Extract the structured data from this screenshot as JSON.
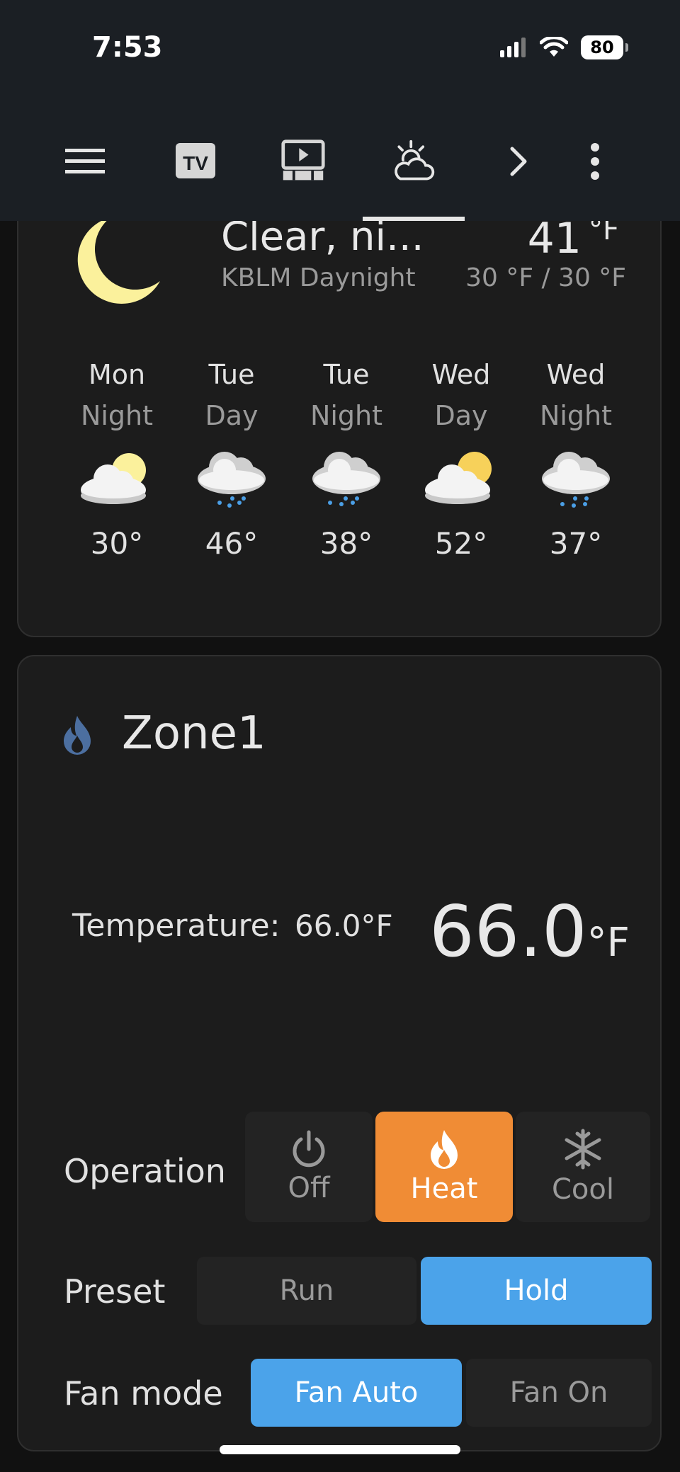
{
  "status": {
    "time": "7:53",
    "battery": "80"
  },
  "toolbar": {
    "icons": [
      "menu-icon",
      "tv-icon",
      "media-icon",
      "weather-icon",
      "chevron-right-icon",
      "more-vert-icon"
    ]
  },
  "weather": {
    "condition": "Clear, ni...",
    "station": "KBLM Daynight",
    "temperature": "41",
    "unit": "°F",
    "hilo": "30 °F / 30 °F",
    "forecast": [
      {
        "day": "Mon",
        "period": "Night",
        "temp": "30°",
        "icon": "partly-cloudy-icon"
      },
      {
        "day": "Tue",
        "period": "Day",
        "temp": "46°",
        "icon": "rain-icon"
      },
      {
        "day": "Tue",
        "period": "Night",
        "temp": "38°",
        "icon": "rain-icon"
      },
      {
        "day": "Wed",
        "period": "Day",
        "temp": "52°",
        "icon": "partly-cloudy-icon"
      },
      {
        "day": "Wed",
        "period": "Night",
        "temp": "37°",
        "icon": "rain-icon"
      }
    ]
  },
  "zone": {
    "title": "Zone1",
    "temperature_label": "Temperature:",
    "temperature_small": "66.0°F",
    "temperature_big": "66.0",
    "temperature_unit": "°F",
    "operation": {
      "label": "Operation",
      "options": [
        {
          "label": "Off",
          "icon": "power-icon",
          "active": false
        },
        {
          "label": "Heat",
          "icon": "flame-icon",
          "active": true
        },
        {
          "label": "Cool",
          "icon": "snowflake-icon",
          "active": false
        }
      ]
    },
    "preset": {
      "label": "Preset",
      "options": [
        "Run",
        "Hold"
      ],
      "selected": "Hold"
    },
    "fan": {
      "label": "Fan mode",
      "options": [
        "Fan Auto",
        "Fan On"
      ],
      "selected": "Fan Auto"
    }
  },
  "colors": {
    "heat_active": "#f08c35",
    "selected_blue": "#4ba3ea",
    "header_bg": "#1b1f24",
    "card_bg": "#1c1c1c"
  }
}
